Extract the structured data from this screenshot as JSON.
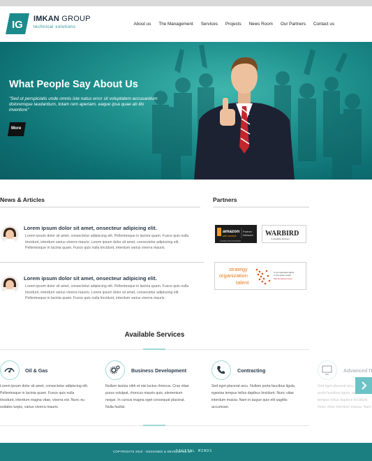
{
  "brand": {
    "name_bold": "IMKAN",
    "name_rest": " GROUP",
    "tagline": "technical solutions",
    "mark": "IG"
  },
  "nav": [
    {
      "label": "About us"
    },
    {
      "label": "The Management"
    },
    {
      "label": "Services"
    },
    {
      "label": "Projects"
    },
    {
      "label": "News Room"
    },
    {
      "label": "Our Partners"
    },
    {
      "label": "Contact us"
    }
  ],
  "hero": {
    "title": "What People Say About Us",
    "quote": "\"Sed ut perspiciatis unde omnis iste natus error sit voluptatem accusantium doloremque laudantium, totam rem aperiam, eaque ipsa quae ab illo inventore\"",
    "more_label": "More"
  },
  "news": {
    "heading": "News & Articles",
    "items": [
      {
        "title": "Lorem ipsum dolor sit amet, onsecteur adipicing elit.",
        "body": "Lorem ipsum dolor sit amet, consectetur adipiscing elit. Pellentesque in lacinia quam. Fusce quis nulla tincidunt, interdum varius viverra mauris. Lorem ipsum dolor sit amet, consectetur adipiscing elit. Pellentesque in lacinia quam. Fusce quis nulla tincidunt, interdum varius viverra mauris."
      },
      {
        "title": "Lorem ipsum dolor sit amet, onsecteur adipicing elit.",
        "body": "Lorem ipsum dolor sit amet, consectetur adipiscing elit. Pellentesque in lacinia quam. Fusce quis nulla tincidunt, interdum varius viverra mauris. Lorem ipsum dolor sit amet, consectetur adipiscing elit. Pellentesque in lacinia quam. Fusce quis nulla tincidunt, interdum varius viverra mauris."
      }
    ]
  },
  "partners": {
    "heading": "Partners",
    "amazon": {
      "line1": "amazon",
      "line2": "web services",
      "line3": "Partner",
      "line4": "Network",
      "line5": "CONSULTING PARTNER"
    },
    "warbird": {
      "name": "WARBIRD",
      "sub": "Consulting Partners"
    },
    "sot": {
      "line1": "strategy",
      "line2": "organization",
      "line3": "talent",
      "note1": "Is your organization aligned",
      "note2": "to drive greater results?",
      "note3": "Take the Alignment score."
    }
  },
  "services": {
    "heading": "Available Services",
    "items": [
      {
        "title": "Oil & Gas",
        "body": "Lorem ipsum dolor sit amet, consectetur adipiscing elit. Pellentesque in lacinia quam. Fusce quis nulla tincidunt, interdum magna vitae, viverra est. Nunc eu sodales turpis, varius viverra mauris."
      },
      {
        "title": "Business Development",
        "body": "Nullam lacinia nibh et nisi luctus rhoncus. Cras vitae purus volutpat, rhoncus mauris quis, elementum neque. In cursus magna eget consequat placerat. Nulla facilisi."
      },
      {
        "title": "Contracting",
        "body": "Sed eget placerat arcu. Nullam porta faucibus ligula, egestas tempus tellus dapibus tincidunt. Nunc vitae interdum massa. Nam in augue quis elit sagittis accumsan."
      },
      {
        "title": "Advanced IT",
        "body": "Sed eget placerat arcu. Nullam porta faucibus ligula, egestas tempus tellus dapibus tincidunt. Nunc vitae interdum massa. Nam in augue quis elit sagittis accumsan."
      }
    ]
  },
  "footer": {
    "copyright": "COPYRIGHTS 2010 - DESIGNED & DEVELOPED BY",
    "developer": "DIGITAL MINDS"
  },
  "colors": {
    "teal": "#1b7f82",
    "teal_light": "#9fd6d6",
    "hero": "#1e8f8c"
  }
}
